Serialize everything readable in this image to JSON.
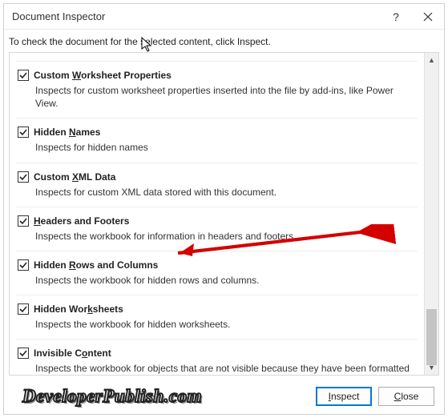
{
  "titlebar": {
    "title": "Document Inspector"
  },
  "instruction": "To check the document for the selected content, click Inspect.",
  "partial_item": "",
  "items": [
    {
      "title_pre": "Custom ",
      "title_ul": "W",
      "title_post": "orksheet Properties",
      "desc": "Inspects for custom worksheet properties inserted into the file by add-ins, like Power View."
    },
    {
      "title_pre": "Hidden ",
      "title_ul": "N",
      "title_post": "ames",
      "desc": "Inspects for hidden names"
    },
    {
      "title_pre": "Custom ",
      "title_ul": "X",
      "title_post": "ML Data",
      "desc": "Inspects for custom XML data stored with this document."
    },
    {
      "title_pre": "",
      "title_ul": "H",
      "title_post": "eaders and Footers",
      "desc": "Inspects the workbook for information in headers and footers."
    },
    {
      "title_pre": "Hidden ",
      "title_ul": "R",
      "title_post": "ows and Columns",
      "desc": "Inspects the workbook for hidden rows and columns."
    },
    {
      "title_pre": "Hidden Wor",
      "title_ul": "k",
      "title_post": "sheets",
      "desc": "Inspects the workbook for hidden worksheets."
    },
    {
      "title_pre": "Invisible C",
      "title_ul": "o",
      "title_post": "ntent",
      "desc": "Inspects the workbook for objects that are not visible because they have been formatted as invisible. This does not include objects that are covered by other objects."
    }
  ],
  "buttons": {
    "inspect_pre": "",
    "inspect_ul": "I",
    "inspect_post": "nspect",
    "close_pre": "",
    "close_ul": "C",
    "close_post": "lose"
  },
  "watermark": "DeveloperPublish.com"
}
